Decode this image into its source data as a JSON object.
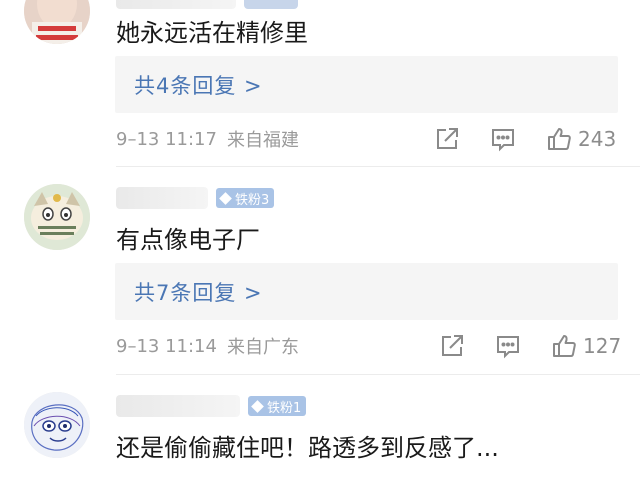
{
  "comments": [
    {
      "text": "她永远活在精修里",
      "reply_label": "共4条回复 >",
      "date": "9–13 11:17",
      "location": "来自福建",
      "likes": "243"
    },
    {
      "badge": "铁粉3",
      "text": "有点像电子厂",
      "reply_label": "共7条回复 >",
      "date": "9–13 11:14",
      "location": "来自广东",
      "likes": "127"
    },
    {
      "badge": "铁粉1",
      "text": "还是偷偷藏住吧！路透多到反感了..."
    }
  ],
  "icons": [
    "share-icon",
    "comment-icon",
    "like-icon",
    "fan-diamond-icon"
  ],
  "colors": {
    "link": "#4a76b4",
    "badge": "#a9c3e6",
    "meta": "#9a9a9a"
  }
}
